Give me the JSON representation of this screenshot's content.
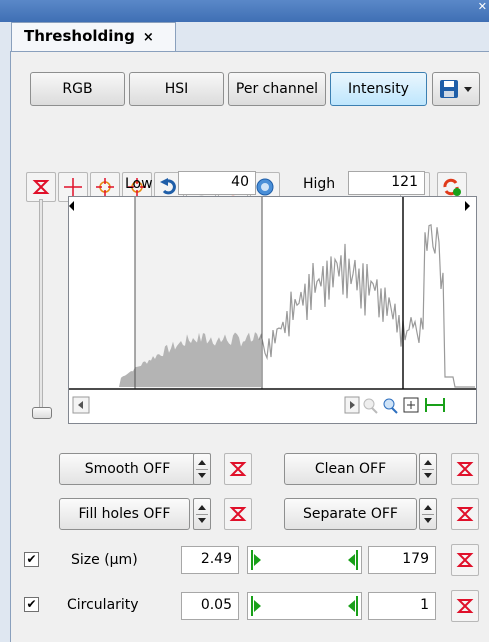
{
  "panel": {
    "tab_title": "Thresholding",
    "tab_close": "×"
  },
  "mode_buttons": [
    {
      "label": "RGB",
      "active": false
    },
    {
      "label": "HSI",
      "active": false
    },
    {
      "label": "Per channel",
      "active": false
    },
    {
      "label": "Intensity",
      "active": true
    }
  ],
  "toolbar_icons": [
    "reset-threshold-icon",
    "crosshair-icon",
    "crosshair-add-icon",
    "crosshair-remove-icon",
    "undo-icon",
    "redo-icon",
    "refresh-icon",
    "auto-threshold-icon",
    "apply-mask-icon",
    "apply-refresh-icon",
    "save-icon"
  ],
  "threshold": {
    "low_label": "Low",
    "low_value": "40",
    "high_label": "High",
    "high_value": "121"
  },
  "histogram": {
    "low_marker": 40,
    "high_marker": 121,
    "extra_marker": 206,
    "x_range": [
      0,
      255
    ],
    "zoom_icons": [
      "zoom-out-icon",
      "zoom-in-icon",
      "fit-icon",
      "fit-width-icon"
    ]
  },
  "options": {
    "smooth": "Smooth OFF",
    "clean": "Clean OFF",
    "fill_holes": "Fill holes OFF",
    "separate": "Separate OFF"
  },
  "filters": [
    {
      "label": "Size (µm)",
      "min": "2.49",
      "max": "179",
      "checked": true
    },
    {
      "label": "Circularity",
      "min": "0.05",
      "max": "1",
      "checked": true
    }
  ],
  "colors": {
    "accent": "#3c7fb1",
    "reset_red": "#e0102a",
    "range_green": "#19a019",
    "titlebar": "#4a7bbf"
  }
}
